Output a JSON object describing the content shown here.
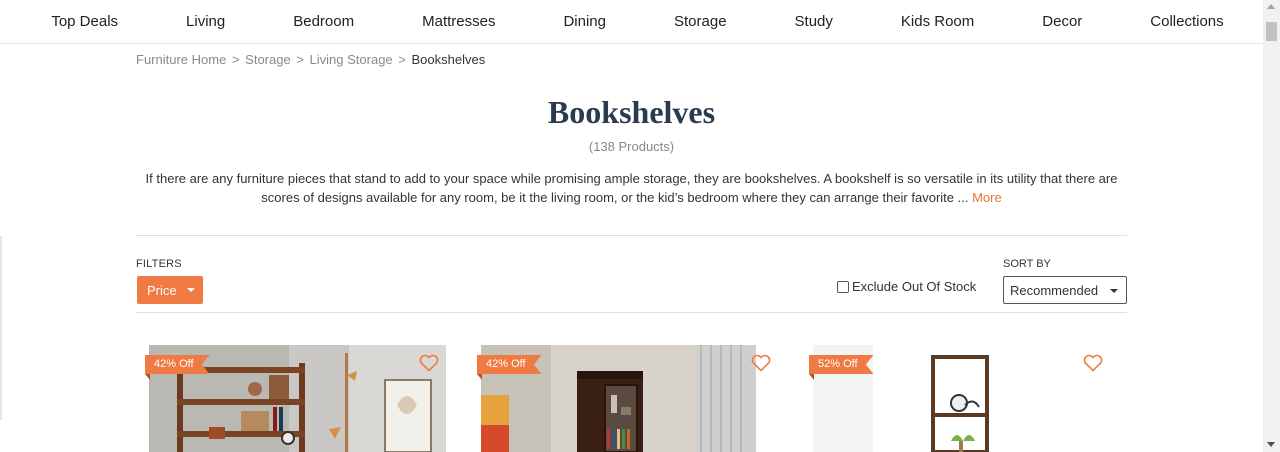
{
  "nav": {
    "items": [
      "Top Deals",
      "Living",
      "Bedroom",
      "Mattresses",
      "Dining",
      "Storage",
      "Study",
      "Kids Room",
      "Decor",
      "Collections"
    ]
  },
  "breadcrumb": {
    "items": [
      "Furniture Home",
      "Storage",
      "Living Storage"
    ],
    "separator": ">",
    "current": "Bookshelves"
  },
  "header": {
    "title": "Bookshelves",
    "count": "(138 Products)"
  },
  "description": {
    "text": "If there are any furniture pieces that stand to add to your space while promising ample storage, they are bookshelves. A bookshelf is so versatile in its utility that there are scores of designs available for any room, be it the living room, or the kid’s bedroom where they can arrange their favorite ... ",
    "more_label": "More"
  },
  "filters": {
    "label": "FILTERS",
    "price_label": "Price",
    "exclude_label": "Exclude Out Of Stock",
    "exclude_checked": false
  },
  "sort": {
    "label": "SORT BY",
    "selected": "Recommended"
  },
  "products": [
    {
      "badge": "42% Off"
    },
    {
      "badge": "42% Off"
    },
    {
      "badge": "52% Off"
    }
  ],
  "colors": {
    "accent": "#f07a43",
    "title": "#2a3a4f",
    "more_link": "#e8743b"
  }
}
